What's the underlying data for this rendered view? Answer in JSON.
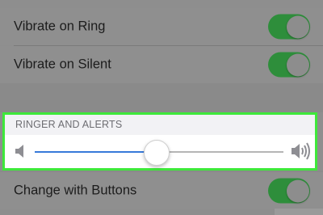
{
  "settings": {
    "vibrate_on_ring": {
      "label": "Vibrate on Ring",
      "on": true
    },
    "vibrate_on_silent": {
      "label": "Vibrate on Silent",
      "on": true
    },
    "ringer_and_alerts": {
      "header": "RINGER AND ALERTS",
      "volume_fraction": 0.49
    },
    "change_with_buttons": {
      "label": "Change with Buttons",
      "on": true
    }
  },
  "colors": {
    "highlight_border": "#3ee83a",
    "toggle_on": "#2e8e3b",
    "slider_fill": "#3779d9"
  },
  "icons": {
    "volume_min": "speaker-low-icon",
    "volume_max": "speaker-high-icon"
  }
}
